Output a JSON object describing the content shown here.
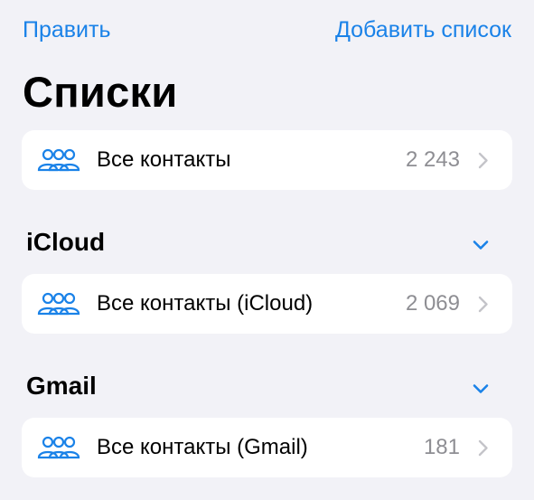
{
  "nav": {
    "edit_label": "Править",
    "add_list_label": "Добавить список"
  },
  "title": "Списки",
  "all_contacts": {
    "label": "Все контакты",
    "count": "2 243",
    "icon": "people-group-icon"
  },
  "sections": [
    {
      "header": "iCloud",
      "rows": [
        {
          "label": "Все контакты (iCloud)",
          "count": "2 069",
          "icon": "people-group-icon"
        }
      ]
    },
    {
      "header": "Gmail",
      "rows": [
        {
          "label": "Все контакты (Gmail)",
          "count": "181",
          "icon": "people-group-icon"
        }
      ]
    }
  ],
  "colors": {
    "accent": "#1a82e8",
    "background": "#f2f2f7",
    "card": "#ffffff",
    "secondary_text": "#8e8e93",
    "chevron": "#c4c4c9"
  }
}
